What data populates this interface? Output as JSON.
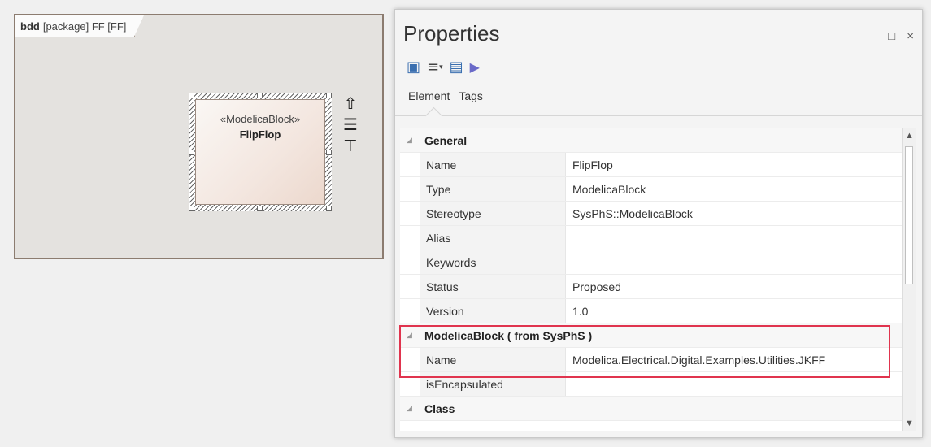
{
  "diagram": {
    "frame_kind": "bdd",
    "frame_name": "[package] FF [FF]",
    "block": {
      "stereotype": "«ModelicaBlock»",
      "name": "FlipFlop"
    },
    "side_icons": [
      "arrow-up-icon",
      "list-icon",
      "port-icon"
    ]
  },
  "panel": {
    "title": "Properties",
    "controls": {
      "maximize": "□",
      "close": "×"
    },
    "toolbar": [
      "save-icon",
      "menu-icon",
      "image-icon",
      "play-icon"
    ],
    "tabs": [
      "Element",
      "Tags"
    ],
    "active_tab": "Element",
    "groups": [
      {
        "label": "General",
        "rows": [
          {
            "key": "Name",
            "value": "FlipFlop"
          },
          {
            "key": "Type",
            "value": "ModelicaBlock"
          },
          {
            "key": "Stereotype",
            "value": "SysPhS::ModelicaBlock"
          },
          {
            "key": "Alias",
            "value": ""
          },
          {
            "key": "Keywords",
            "value": ""
          },
          {
            "key": "Status",
            "value": "Proposed"
          },
          {
            "key": "Version",
            "value": "1.0"
          }
        ]
      },
      {
        "label": "ModelicaBlock  ( from SysPhS )",
        "rows": [
          {
            "key": "Name",
            "value": "Modelica.Electrical.Digital.Examples.Utilities.JKFF"
          },
          {
            "key": "isEncapsulated",
            "value": ""
          }
        ]
      },
      {
        "label": "Class",
        "rows": []
      }
    ]
  },
  "colors": {
    "highlight": "#e0344e",
    "frame": "#8c7c70"
  }
}
